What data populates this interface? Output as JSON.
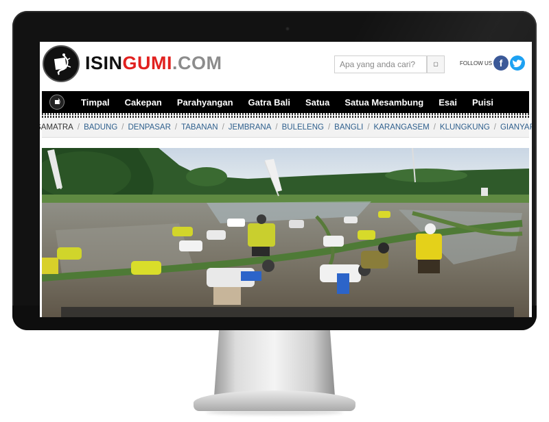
{
  "site": {
    "logo_badge_text": "ISIN GUMI",
    "logo_part1": "ISIN",
    "logo_part2": "GUMI",
    "logo_part3": ".COM"
  },
  "search": {
    "placeholder": "Apa yang anda cari?",
    "button_icon": "search-icon"
  },
  "social": {
    "follow_label": "FOLLOW US :",
    "facebook_icon": "facebook-icon",
    "twitter_icon": "twitter-icon"
  },
  "nav": {
    "home_icon": "home-logo-icon",
    "items": [
      "Timpal",
      "Cakepan",
      "Parahyangan",
      "Gatra Bali",
      "Satua",
      "Satua Mesambung",
      "Esai",
      "Puisi"
    ]
  },
  "regions": {
    "items": [
      "SAMATRA",
      "BADUNG",
      "DENPASAR",
      "TABANAN",
      "JEMBRANA",
      "BULELENG",
      "BANGLI",
      "KARANGASEM",
      "KLUNGKUNG",
      "GIANYAR"
    ],
    "separator": "/"
  },
  "colors": {
    "nav_bg": "#000000",
    "region_link": "#2d5e8c",
    "logo_red": "#e1211f",
    "logo_gray": "#8c8c8c"
  }
}
